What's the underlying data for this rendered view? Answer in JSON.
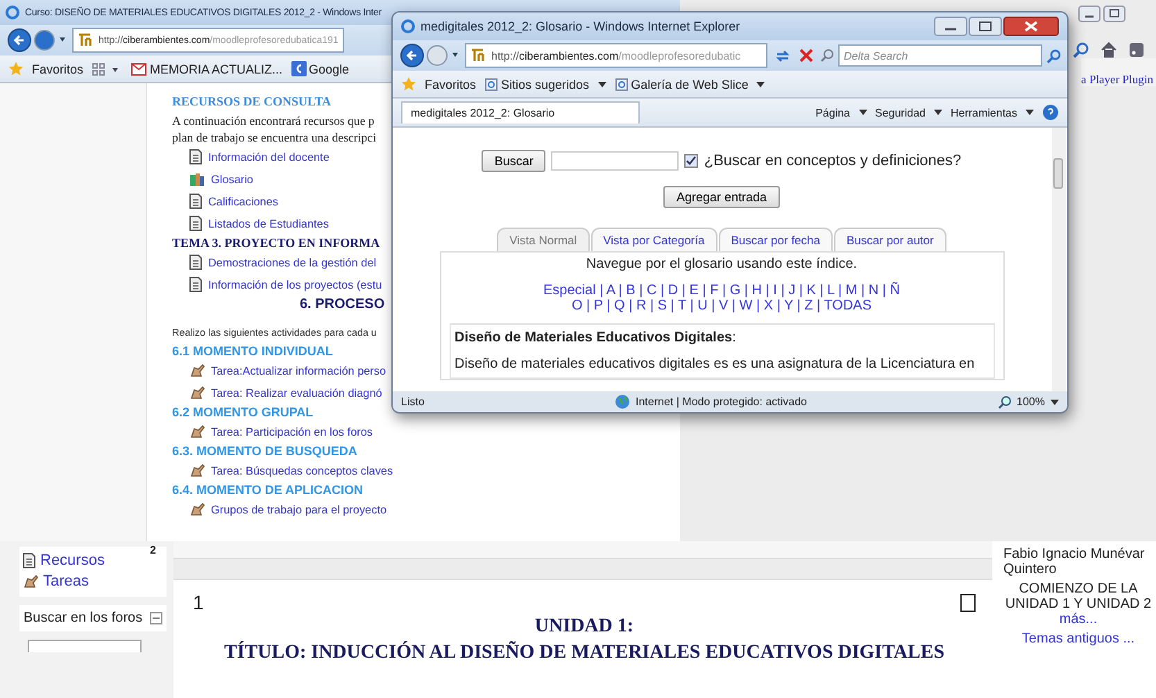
{
  "back_window": {
    "title": "Curso: DISEÑO DE MATERIALES EDUCATIVOS DIGITALES 2012_2 - Windows Inter",
    "address": {
      "scheme": "http://",
      "domain": "ciberambientes.com",
      "path": "/moodleprofesoredubatica191"
    },
    "favorites_label": "Favoritos",
    "favorites": [
      {
        "label": "MEMORIA ACTUALIZ...",
        "kind": "mail"
      },
      {
        "label": "Google",
        "kind": "search"
      }
    ]
  },
  "course": {
    "resources_heading": "RECURSOS DE CONSULTA",
    "intro": [
      "A continuación encontrará recursos que p",
      "plan de trabajo se encuentra una descripci"
    ],
    "resources": [
      {
        "label": "Información del docente",
        "kind": "page"
      },
      {
        "label": "Glosario",
        "kind": "glossary"
      },
      {
        "label": "Calificaciones",
        "kind": "page"
      },
      {
        "label": "Listados de Estudiantes",
        "kind": "page"
      }
    ],
    "topic_heading": "TEMA 3. PROYECTO EN INFORMA",
    "topic_items": [
      {
        "label": "Demostraciones de la gestión del",
        "kind": "page"
      },
      {
        "label": "Información de los proyectos (estu",
        "kind": "page"
      }
    ],
    "section_title": "6. PROCESO",
    "instructions": "Realizo las siguientes actividades para cada u",
    "moments": [
      {
        "title": "6.1 MOMENTO INDIVIDUAL",
        "items": [
          {
            "label": "Tarea:Actualizar información perso",
            "kind": "task"
          },
          {
            "label": "Tarea: Realizar evaluación diagnó",
            "kind": "task"
          }
        ]
      },
      {
        "title": "6.2 MOMENTO GRUPAL",
        "items": [
          {
            "label": "Tarea: Participación en los foros",
            "kind": "task"
          }
        ]
      },
      {
        "title": "6.3. MOMENTO DE BUSQUEDA",
        "items": [
          {
            "label": "Tarea: Búsquedas conceptos claves",
            "kind": "task"
          }
        ]
      },
      {
        "title": "6.4. MOMENTO DE APLICACION",
        "items": [
          {
            "label": "Grupos de trabajo para el proyecto",
            "kind": "task"
          }
        ]
      }
    ]
  },
  "right_window": {
    "link": "a Player Plugin"
  },
  "popup": {
    "title": "medigitales 2012_2: Glosario - Windows Internet Explorer",
    "address": {
      "scheme": "http://",
      "domain": "ciberambientes.com",
      "path": "/moodleprofesoredubatic"
    },
    "search": {
      "placeholder": "Delta Search"
    },
    "favorites_label": "Favoritos",
    "favorites": [
      {
        "label": "Sitios sugeridos"
      },
      {
        "label": "Galería de Web Slice"
      }
    ],
    "tab": "medigitales 2012_2: Glosario",
    "commands": [
      "Página",
      "Seguridad",
      "Herramientas"
    ],
    "search_button": "Buscar",
    "search_in_definitions": {
      "label": "¿Buscar en conceptos y definiciones?",
      "checked": true
    },
    "add_button": "Agregar entrada",
    "tabs": [
      {
        "label": "Vista Normal",
        "selected": true
      },
      {
        "label": "Vista por Categoría",
        "selected": false
      },
      {
        "label": "Buscar por fecha",
        "selected": false
      },
      {
        "label": "Buscar por autor",
        "selected": false
      }
    ],
    "index_hint": "Navegue por el glosario usando este índice.",
    "index_rows": [
      "Especial | A | B | C | D | E | F | G | H | I | J | K | L | M | N | Ñ",
      "O | P | Q | R | S | T | U | V | W | X | Y | Z | TODAS"
    ],
    "entry": {
      "title": "Diseño de Materiales Educativos Digitales",
      "punct": ":",
      "text": "Diseño de materiales educativos digitales es es una asignatura de la Licenciatura en"
    },
    "status": {
      "left": "Listo",
      "zone": "Internet | Modo protegido: activado",
      "zoom": "100%"
    }
  },
  "bottom": {
    "block_links": [
      {
        "label": "Recursos",
        "kind": "page"
      },
      {
        "label": "Tareas",
        "kind": "task"
      }
    ],
    "forum_search": "Buscar en los foros",
    "section_2": "2",
    "section_1": "1",
    "unit": "UNIDAD 1:",
    "unit_title": "TÍTULO: INDUCCIÓN AL DISEÑO DE MATERIALES EDUCATIVOS DIGITALES",
    "news": {
      "author": "Fabio Ignacio Munévar Quintero",
      "headline": "COMIENZO DE LA UNIDAD 1 Y UNIDAD 2",
      "more": "más...",
      "older": "Temas antiguos ..."
    }
  }
}
